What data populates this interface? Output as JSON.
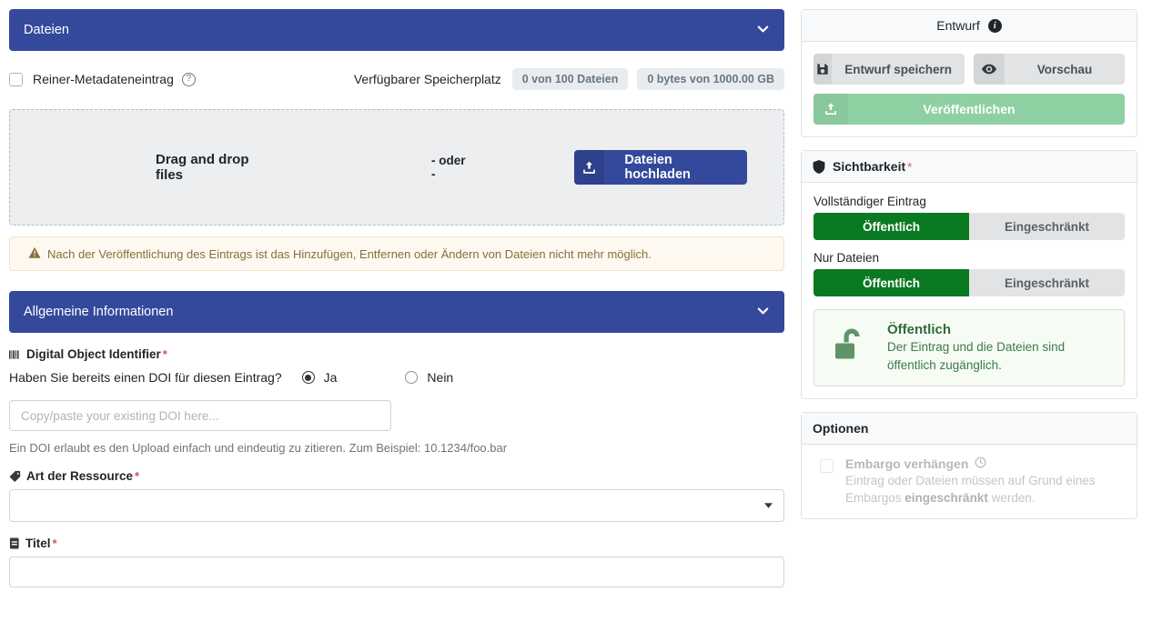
{
  "files_section": {
    "header_title": "Dateien",
    "chevron": "chevron-down",
    "metadata_only_label": "Reiner-Metadateneintrag",
    "help_icon": "?",
    "quota_label": "Verfügbarer Speicherplatz",
    "quota_files": "0 von 100 Dateien",
    "quota_bytes": "0 bytes von 1000.00 GB",
    "dropzone_text": "Drag and drop files",
    "dropzone_or": "- oder -",
    "upload_button": "Dateien hochladen",
    "warning": "Nach der Veröffentlichung des Eintrags ist das Hinzufügen, Entfernen oder Ändern von Dateien nicht mehr möglich."
  },
  "general_section": {
    "header_title": "Allgemeine Informationen",
    "doi_label": "Digital Object Identifier",
    "doi_question": "Haben Sie bereits einen DOI für diesen Eintrag?",
    "doi_yes": "Ja",
    "doi_no": "Nein",
    "doi_placeholder": "Copy/paste your existing DOI here...",
    "doi_value": "",
    "doi_hint": "Ein DOI erlaubt es den Upload einfach und eindeutig zu zitieren. Zum Beispiel: 10.1234/foo.bar",
    "resource_type_label": "Art der Ressource",
    "resource_type_value": "",
    "title_label": "Titel",
    "title_value": "",
    "required_marker": "*"
  },
  "draft_card": {
    "title": "Entwurf",
    "info_icon": "i",
    "save_draft": "Entwurf speichern",
    "preview": "Vorschau",
    "publish": "Veröffentlichen"
  },
  "visibility_card": {
    "title": "Sichtbarkeit",
    "required_marker": "*",
    "full_record_label": "Vollständiger Eintrag",
    "files_only_label": "Nur Dateien",
    "option_public": "Öffentlich",
    "option_restricted": "Eingeschränkt",
    "full_record_selected": "Öffentlich",
    "files_only_selected": "Öffentlich",
    "notice_title": "Öffentlich",
    "notice_body": "Der Eintrag und die Dateien sind öffentlich zugänglich."
  },
  "options_card": {
    "title": "Optionen",
    "embargo_label": "Embargo verhängen",
    "embargo_desc_pre": "Eintrag oder Dateien müssen auf Grund eines Embargos ",
    "embargo_desc_strong": "eingeschränkt",
    "embargo_desc_post": " werden."
  },
  "colors": {
    "header_blue": "#34499c",
    "public_green": "#0a7a22",
    "publish_green": "#8fd0a3",
    "required_red": "#d9534f",
    "warning_text": "#8a6d3b"
  }
}
